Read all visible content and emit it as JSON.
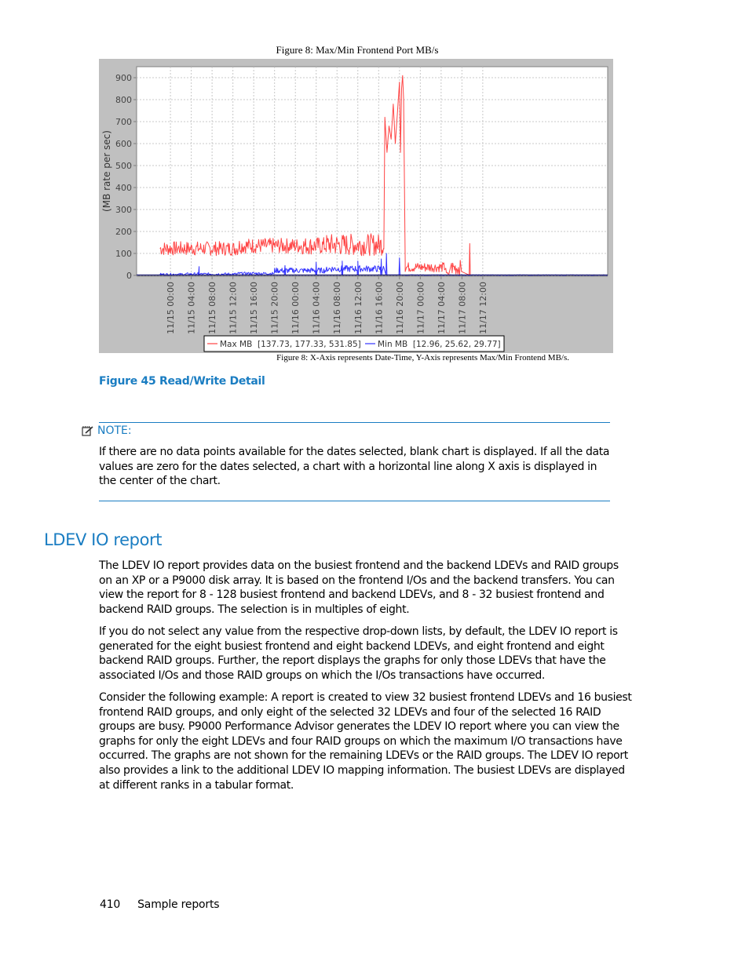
{
  "figure": {
    "title": "Figure 8: Max/Min Frontend Port MB/s",
    "subcaption": "Figure 8: X-Axis represents Date-Time, Y-Axis represents Max/Min Frontend MB/s.",
    "caption": "Figure 45 Read/Write Detail"
  },
  "chart_data": {
    "type": "line",
    "title": "Figure 8: Max/Min Frontend Port MB/s",
    "xlabel": "",
    "ylabel": "(MB rate per sec)",
    "ylim": [
      0,
      950
    ],
    "yticks": [
      0,
      100,
      200,
      300,
      400,
      500,
      600,
      700,
      800,
      900
    ],
    "xlim_hours": [
      -6.5,
      84
    ],
    "xtick_labels": [
      "11/15 00:00",
      "11/15 04:00",
      "11/15 08:00",
      "11/15 12:00",
      "11/15 16:00",
      "11/15 20:00",
      "11/16 00:00",
      "11/16 04:00",
      "11/16 08:00",
      "11/16 12:00",
      "11/16 16:00",
      "11/16 20:00",
      "11/17 00:00",
      "11/17 04:00",
      "11/17 08:00",
      "11/17 12:00"
    ],
    "xtick_hours": [
      0,
      4,
      8,
      12,
      16,
      20,
      24,
      28,
      32,
      36,
      40,
      44,
      48,
      52,
      56,
      60
    ],
    "grid": true,
    "legend_position": "bottom",
    "series": [
      {
        "name": "Max MB",
        "legend_label": "Max MB  [137.73, 177.33, 531.85]",
        "color": "#ff4444",
        "segments": [
          {
            "start_h": -2,
            "end_h": 13,
            "low": 90,
            "high": 155
          },
          {
            "start_h": 13,
            "end_h": 25,
            "low": 100,
            "high": 170
          },
          {
            "start_h": 25,
            "end_h": 30,
            "low": 95,
            "high": 175
          },
          {
            "start_h": 30,
            "end_h": 41,
            "low": 90,
            "high": 190
          }
        ],
        "points": [
          [
            41,
            120
          ],
          [
            41.2,
            720
          ],
          [
            41.6,
            560
          ],
          [
            42,
            680
          ],
          [
            42.4,
            620
          ],
          [
            42.8,
            780
          ],
          [
            43.2,
            600
          ],
          [
            43.6,
            740
          ],
          [
            44,
            880
          ],
          [
            44.2,
            560
          ],
          [
            44.4,
            850
          ],
          [
            44.6,
            910
          ],
          [
            44.8,
            800
          ],
          [
            45.1,
            60
          ]
        ],
        "tail_segments": [
          {
            "start_h": 45.1,
            "end_h": 53,
            "low": 15,
            "high": 60
          },
          {
            "start_h": 53,
            "end_h": 53.5,
            "low": 0,
            "high": 15
          },
          {
            "start_h": 54,
            "end_h": 56,
            "low": 0,
            "high": 70
          }
        ],
        "spikes": [
          [
            57.5,
            145
          ]
        ]
      },
      {
        "name": "Min MB",
        "legend_label": "Min MB  [12.96, 25.62, 29.77]",
        "color": "#3333ff",
        "segments": [
          {
            "start_h": -2,
            "end_h": 3,
            "low": 0,
            "high": 10
          },
          {
            "start_h": 3,
            "end_h": 13,
            "low": 0,
            "high": 12
          },
          {
            "start_h": 13,
            "end_h": 20,
            "low": 3,
            "high": 15
          },
          {
            "start_h": 20,
            "end_h": 30,
            "low": 10,
            "high": 35
          },
          {
            "start_h": 30,
            "end_h": 41,
            "low": 15,
            "high": 45
          }
        ],
        "spikes": [
          [
            5.5,
            40
          ],
          [
            22,
            45
          ],
          [
            28,
            60
          ],
          [
            33,
            65
          ],
          [
            36,
            65
          ],
          [
            40.5,
            75
          ],
          [
            41.5,
            100
          ],
          [
            44,
            80
          ]
        ],
        "tail_segments": [
          {
            "start_h": 45,
            "end_h": 84,
            "low": 0,
            "high": 3
          }
        ]
      }
    ]
  },
  "note": {
    "label": "NOTE:",
    "text": "If there are no data points available for the dates selected, blank chart is displayed. If all the data values are zero for the dates selected, a chart with a horizontal line along X axis is displayed in the center of the chart."
  },
  "section": {
    "title": "LDEV IO report",
    "paragraphs": [
      "The LDEV IO report provides data on the busiest frontend and the backend LDEVs and RAID groups on an XP or a P9000 disk array. It is based on the frontend I/Os and the backend transfers. You can view the report for 8 - 128 busiest frontend and backend LDEVs, and 8 - 32 busiest frontend and backend RAID groups. The selection is in multiples of eight.",
      "If you do not select any value from the respective drop-down lists, by default, the LDEV IO report is generated for the eight busiest frontend and eight backend LDEVs, and eight frontend and eight backend RAID groups. Further, the report displays the graphs for only those LDEVs that have the associated I/Os and those RAID groups on which the I/Os transactions have occurred.",
      "Consider the following example: A report is created to view 32 busiest frontend LDEVs and 16 busiest frontend RAID groups, and only eight of the selected 32 LDEVs and four of the selected 16 RAID groups are busy. P9000 Performance Advisor generates the LDEV IO report where you can view the graphs for only the eight LDEVs and four RAID groups on which the maximum I/O transactions have occurred. The graphs are not shown for the remaining LDEVs or the RAID groups. The LDEV IO report also provides a link to the additional LDEV IO mapping information. The busiest LDEVs are displayed at different ranks in a tabular format."
    ]
  },
  "footer": {
    "page_number": "410",
    "section_name": "Sample reports"
  }
}
